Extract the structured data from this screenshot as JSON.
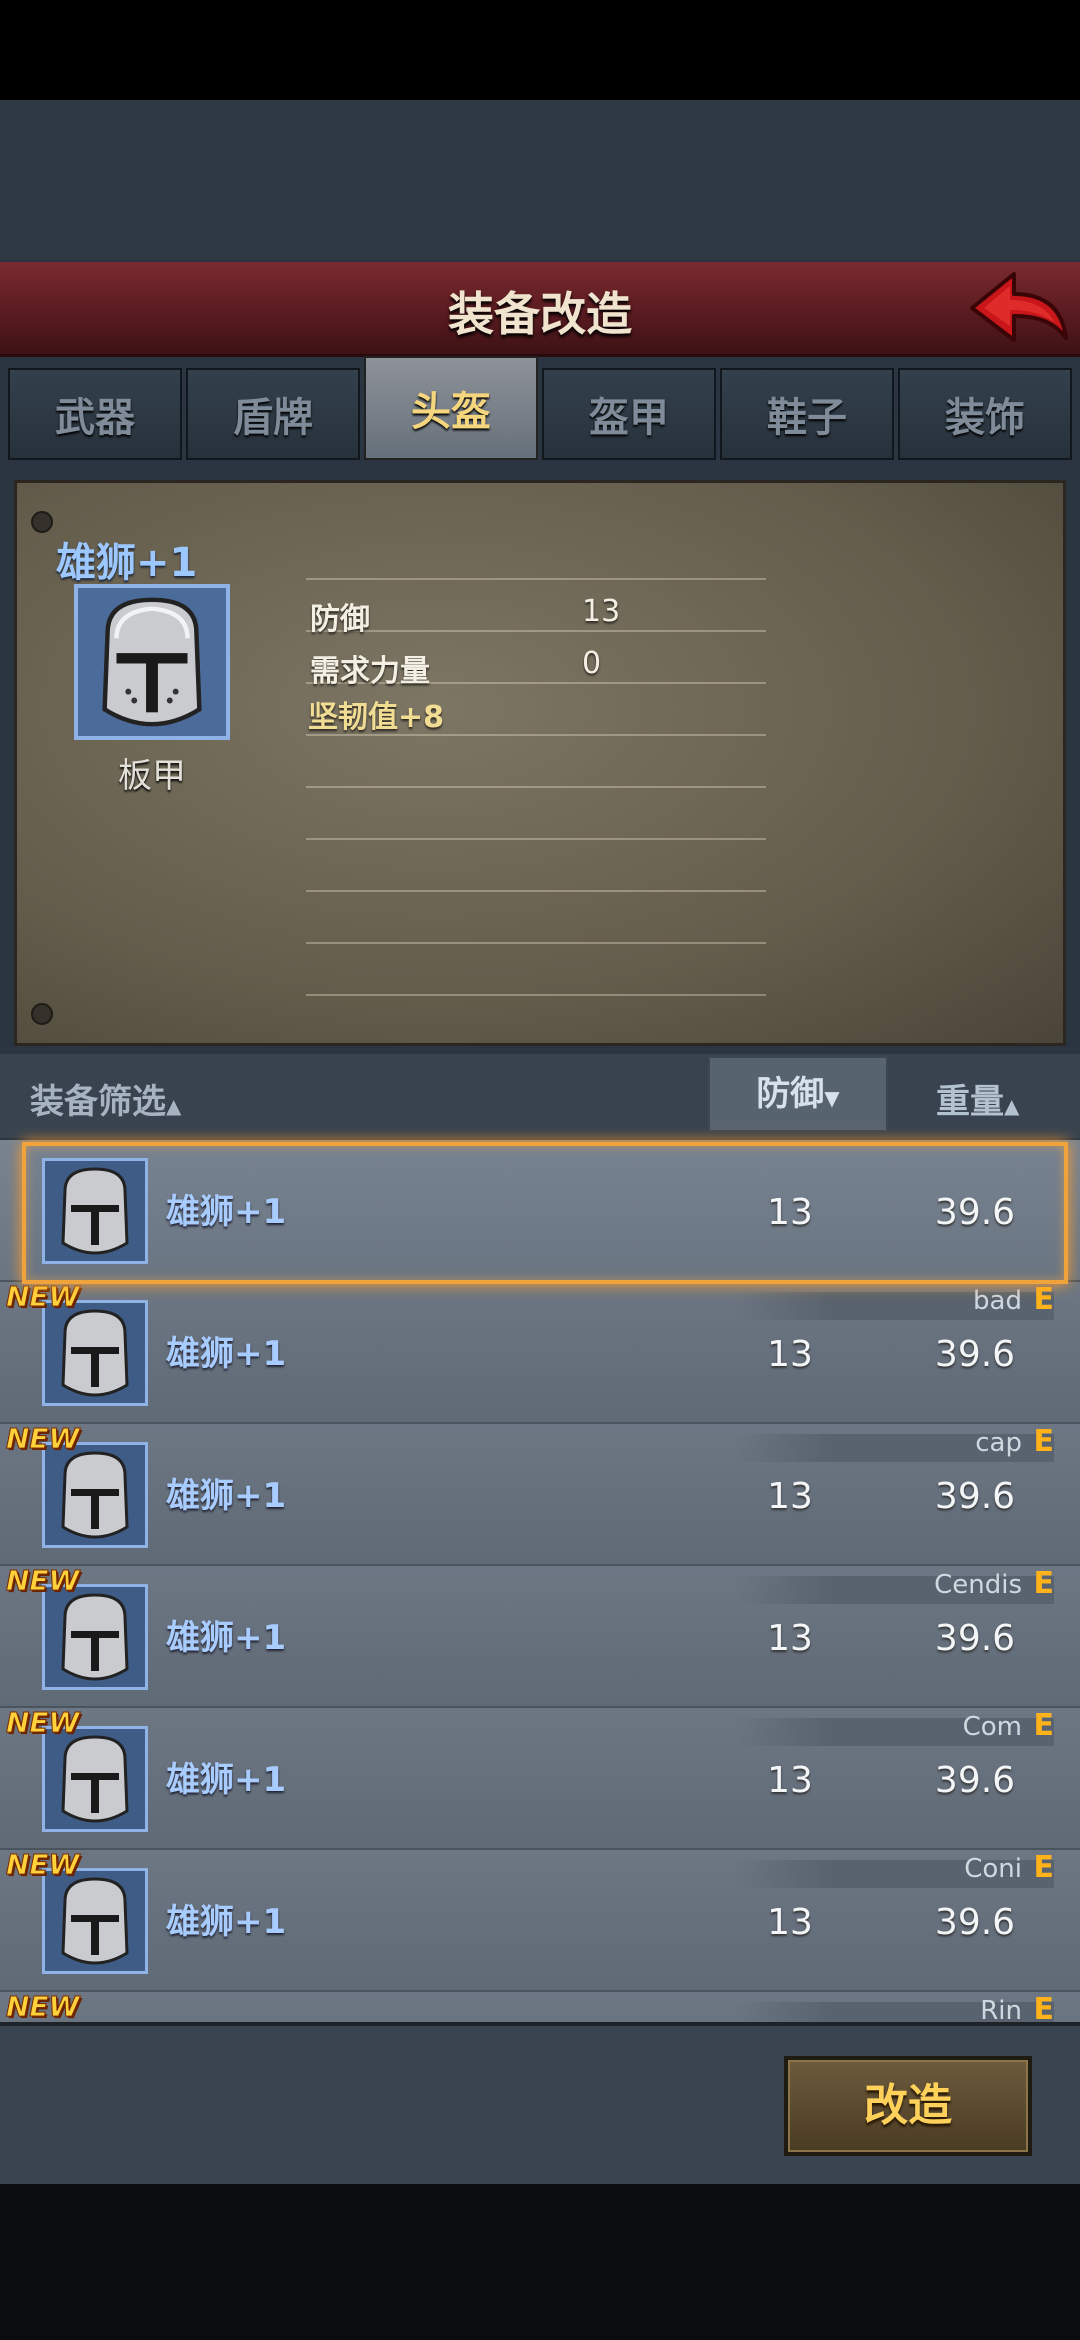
{
  "header": {
    "title": "装备改造"
  },
  "tabs": [
    {
      "label": "武器",
      "active": false
    },
    {
      "label": "盾牌",
      "active": false
    },
    {
      "label": "头盔",
      "active": true
    },
    {
      "label": "盔甲",
      "active": false
    },
    {
      "label": "鞋子",
      "active": false
    },
    {
      "label": "装饰",
      "active": false
    }
  ],
  "selected_item": {
    "name": "雄狮+1",
    "icon": "helmet-icon",
    "type": "板甲",
    "stats": [
      {
        "label": "防御",
        "value": "13"
      },
      {
        "label": "需求力量",
        "value": "0"
      }
    ],
    "bonus": "坚韧值+8"
  },
  "sort": {
    "filter_label": "装备筛选",
    "defense_label": "防御",
    "weight_label": "重量",
    "up_arrow": "▲",
    "down_arrow": "▼"
  },
  "list": {
    "new_label": "NEW",
    "items": [
      {
        "name": "雄狮+1",
        "defense": "13",
        "weight": "39.6",
        "owner": "",
        "grade": "",
        "is_new": false,
        "selected": true
      },
      {
        "name": "雄狮+1",
        "defense": "13",
        "weight": "39.6",
        "owner": "bad",
        "grade": "E",
        "is_new": true,
        "selected": false
      },
      {
        "name": "雄狮+1",
        "defense": "13",
        "weight": "39.6",
        "owner": "cap",
        "grade": "E",
        "is_new": true,
        "selected": false
      },
      {
        "name": "雄狮+1",
        "defense": "13",
        "weight": "39.6",
        "owner": "Cendis",
        "grade": "E",
        "is_new": true,
        "selected": false
      },
      {
        "name": "雄狮+1",
        "defense": "13",
        "weight": "39.6",
        "owner": "Com",
        "grade": "E",
        "is_new": true,
        "selected": false
      },
      {
        "name": "雄狮+1",
        "defense": "13",
        "weight": "39.6",
        "owner": "Coni",
        "grade": "E",
        "is_new": true,
        "selected": false
      },
      {
        "name": "",
        "defense": "",
        "weight": "",
        "owner": "Rin",
        "grade": "E",
        "is_new": true,
        "selected": false
      }
    ]
  },
  "footer": {
    "modify_label": "改造"
  },
  "colors": {
    "title_bar": "#5a1b20",
    "accent_gold": "#ffd15a",
    "selection_orange": "#f0a33a",
    "item_name_blue": "#a9ccff"
  }
}
